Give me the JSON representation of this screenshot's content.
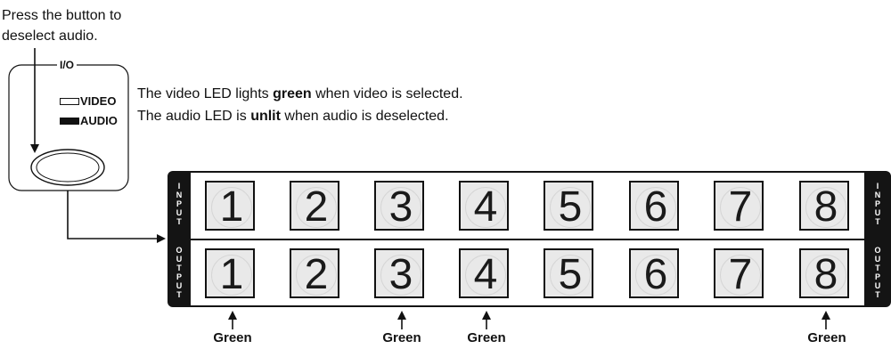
{
  "caption": {
    "line1": "Press the button to",
    "line2": "deselect audio."
  },
  "io_panel": {
    "title": "I/O",
    "video_label": "VIDEO",
    "audio_label": "AUDIO",
    "video_led_state": "outline",
    "audio_led_state": "filled"
  },
  "notes": {
    "video": {
      "pre": "The video LED lights ",
      "bold": "green",
      "post": " when video is selected."
    },
    "audio": {
      "pre": "The audio LED is ",
      "bold": "unlit",
      "post": " when audio is deselected."
    }
  },
  "matrix": {
    "input_letters": [
      "I",
      "N",
      "P",
      "U",
      "T"
    ],
    "output_letters": [
      "O",
      "U",
      "T",
      "P",
      "U",
      "T"
    ],
    "input_buttons": [
      "1",
      "2",
      "3",
      "4",
      "5",
      "6",
      "7",
      "8"
    ],
    "output_buttons": [
      "1",
      "2",
      "3",
      "4",
      "5",
      "6",
      "7",
      "8"
    ],
    "green_outputs": [
      "1",
      "3",
      "4",
      "8"
    ],
    "green_label": "Green"
  },
  "colors": {
    "panel": "#141414",
    "key_bg": "#e9e9e9",
    "line": "#111111"
  }
}
